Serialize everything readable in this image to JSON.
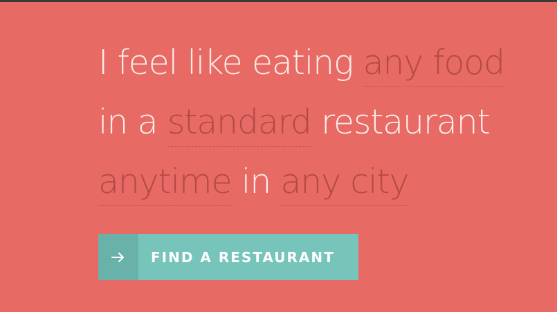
{
  "sentence": {
    "line1": {
      "prefix": "I feel like eating",
      "food": "any food"
    },
    "line2": {
      "prefix": "in a",
      "type": "standard",
      "suffix": "restaurant"
    },
    "line3": {
      "time": "anytime",
      "connector": "in",
      "city": "any city"
    }
  },
  "action": {
    "button_label": "FIND A RESTAURANT",
    "icon": "arrow-right-icon"
  },
  "colors": {
    "background": "#e86a64",
    "choice_text": "#b24a46",
    "button": "#77c4bb",
    "button_icon_bg": "#69b2a9"
  }
}
